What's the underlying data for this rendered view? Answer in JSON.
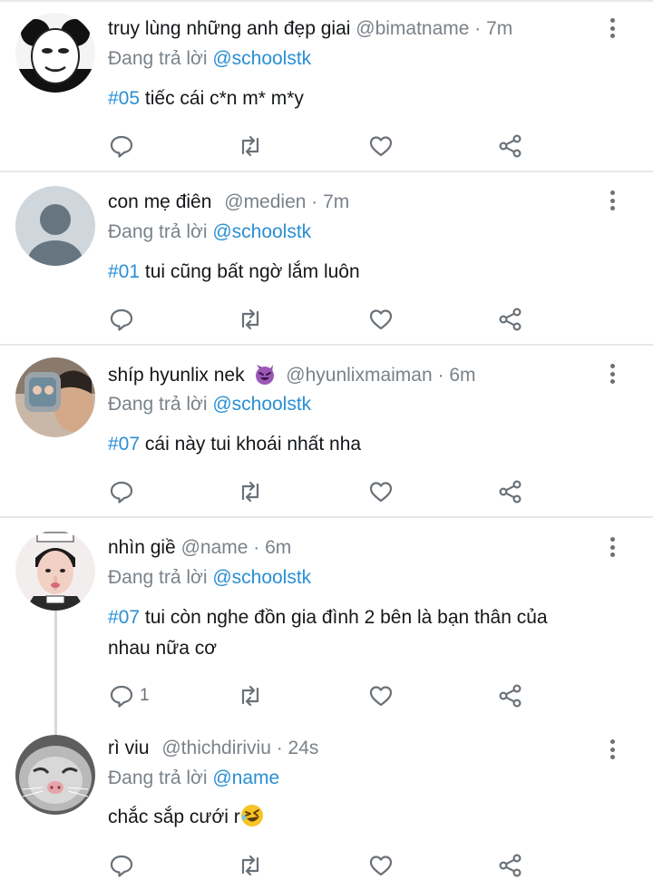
{
  "tweets": [
    {
      "name": "truy lùng những anh đẹp giai",
      "handle": "@bimatname · 7m",
      "reply_prefix": "Đang trả lời",
      "reply_to": "@schoolstk",
      "tag": "#05",
      "text": "tiếc cái c*n m* m*y",
      "text2": "",
      "reply_count": "",
      "avatar": "panda-meme-avatar"
    },
    {
      "name": "con mẹ điên",
      "handle": "@medien · 7m",
      "reply_prefix": "Đang trả lời",
      "reply_to": "@schoolstk",
      "tag": "#01",
      "text": "tui cũng bất ngờ lắm luôn",
      "text2": "",
      "reply_count": "",
      "avatar": "default-avatar"
    },
    {
      "name": "shíp hyunlix nek",
      "handle": "@hyunlixmaiman · 6m",
      "reply_prefix": "Đang trả lời",
      "reply_to": "@schoolstk",
      "tag": "#07",
      "text": "cái này tui khoái nhất nha",
      "text2": "",
      "reply_count": "",
      "avatar": "photo-avatar",
      "name_emoji": "smiling-devil-emoji"
    },
    {
      "name": "nhìn giề",
      "handle": "@name · 6m",
      "reply_prefix": "Đang trả lời",
      "reply_to": "@schoolstk",
      "tag": "#07",
      "text": "tui còn nghe đồn gia đình 2 bên là bạn thân của",
      "text2": "nhau nữa cơ",
      "reply_count": "1",
      "avatar": "photo-avatar"
    },
    {
      "name": "rì viu",
      "handle": "@thichdiriviu · 24s",
      "reply_prefix": "Đang trả lời",
      "reply_to": "@name",
      "tag": "",
      "text": "chắc sắp cưới r",
      "text2": "",
      "reply_count": "",
      "avatar": "cat-photo-avatar",
      "text_emoji": "rolling-laughing-emoji"
    }
  ],
  "icons": {
    "reply": "reply-icon",
    "retweet": "retweet-icon",
    "like": "like-icon",
    "share": "share-icon",
    "more": "more-icon"
  },
  "colors": {
    "accent": "#2a8fd4",
    "muted": "#7a8289",
    "icon": "#6a7178",
    "divider": "#e6e8ea"
  }
}
